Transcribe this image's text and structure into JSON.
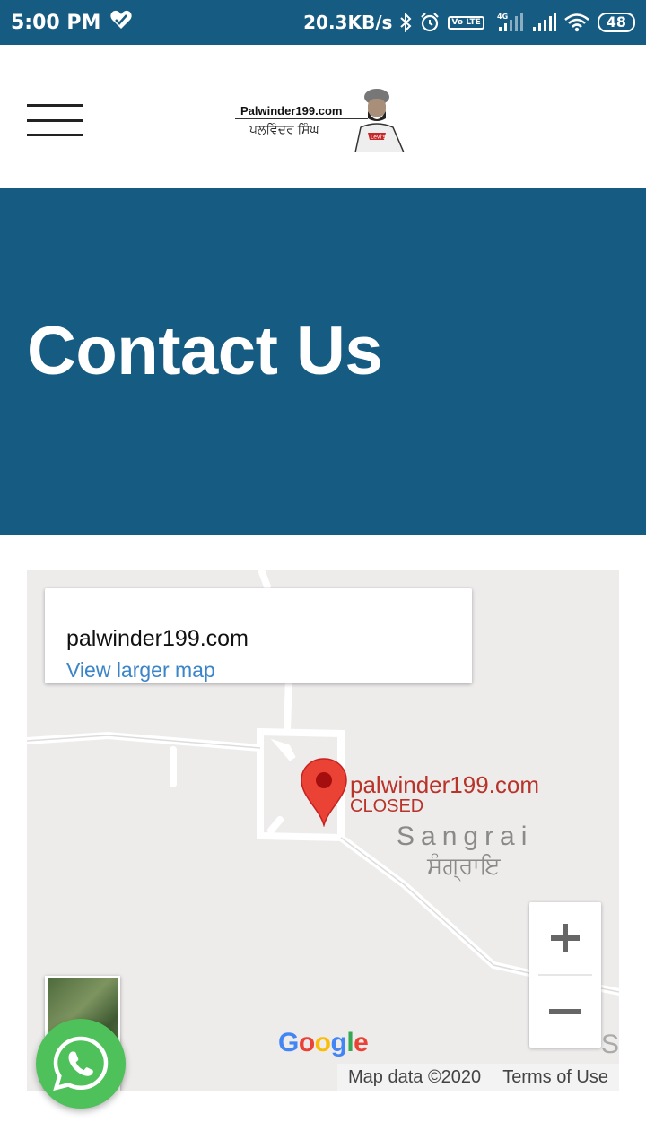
{
  "status_bar": {
    "time": "5:00 PM",
    "network_speed": "20.3KB/s",
    "lte_label": "Vo LTE",
    "net_type": "4G",
    "battery": "48",
    "icons": [
      "heart-icon",
      "bluetooth-icon",
      "alarm-icon",
      "volte-icon",
      "signal-icon",
      "signal-icon",
      "wifi-icon",
      "battery-icon"
    ]
  },
  "header": {
    "logo_text": "Palwinder199.com",
    "logo_punjabi": "ਪਲਵਿੰਦਰ ਸਿੰਘ",
    "logo_shirt": "Levi's",
    "menu_icon": "hamburger-menu-icon"
  },
  "hero": {
    "title": "Contact Us"
  },
  "map": {
    "info_card": {
      "place_name": "palwinder199.com",
      "link_label": "View larger map"
    },
    "marker": {
      "label": "palwinder199.com",
      "status": "CLOSED"
    },
    "town_name": "Sangrai",
    "town_name_punjabi": "ਸੰਗ੍ਰਾਇ",
    "edge_letter": "S",
    "google_logo": [
      "G",
      "o",
      "o",
      "g",
      "l",
      "e"
    ],
    "attribution": {
      "map_data": "Map data ©2020",
      "terms": "Terms of Use"
    },
    "zoom_in_icon": "plus-icon",
    "zoom_out_icon": "minus-icon"
  },
  "colors": {
    "brand_blue": "#165b82",
    "link_blue": "#3a84c8",
    "marker_red": "#ea4335",
    "whatsapp_green": "#4ec15a"
  }
}
